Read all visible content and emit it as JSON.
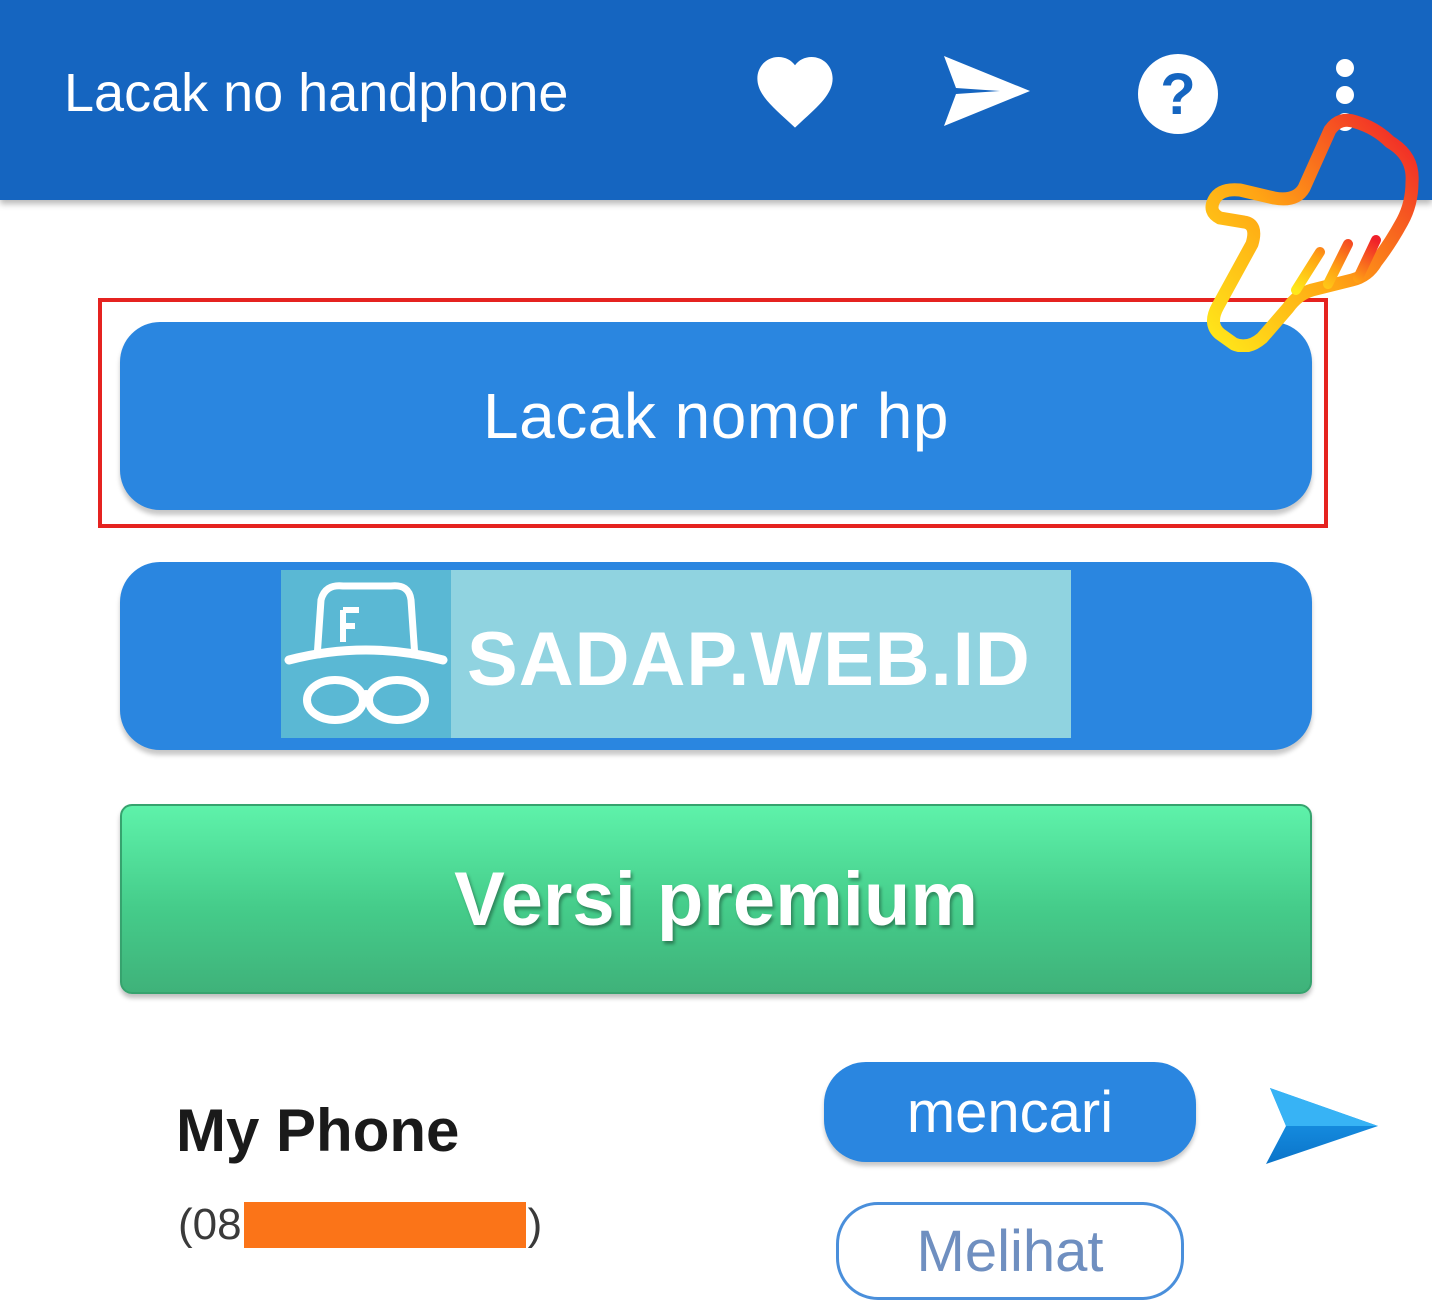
{
  "appbar": {
    "title": "Lacak no handphone",
    "background": "#1565c0",
    "actions": [
      {
        "icon": "heart-icon"
      },
      {
        "icon": "send-icon"
      },
      {
        "icon": "help-icon"
      },
      {
        "icon": "more-vert-icon"
      }
    ]
  },
  "main": {
    "track_button_label": "Lacak nomor hp",
    "watermark_text": "SADAP.WEB.ID",
    "premium_button_label": "Versi premium"
  },
  "phone_item": {
    "name": "My Phone",
    "number_prefix": "(08",
    "number_suffix": ")",
    "search_button_label": "mencari",
    "view_button_label": "Melihat"
  },
  "colors": {
    "primary": "#2a86e0",
    "appbar": "#1565c0",
    "premium_green": "#45cc8a",
    "highlight_red": "#e52320",
    "redaction_orange": "#fb7418"
  }
}
